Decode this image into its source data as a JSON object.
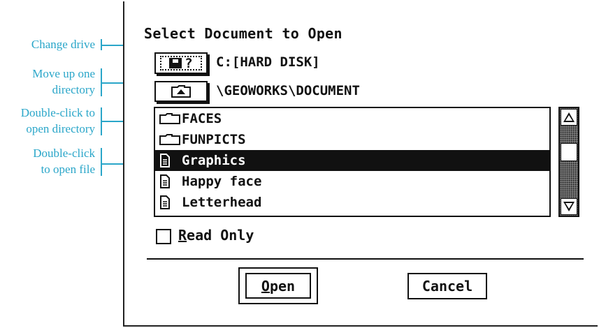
{
  "callouts": {
    "change_drive": "Change drive",
    "move_up_line1": "Move up one",
    "move_up_line2": "directory",
    "open_dir_line1": "Double-click to",
    "open_dir_line2": "open directory",
    "open_file_line1": "Double-click",
    "open_file_line2": "to open file"
  },
  "dialog": {
    "title": "Select Document to Open",
    "drive_button_label": "?",
    "drive_label": "C:[HARD DISK]",
    "path_label": "\\GEOWORKS\\DOCUMENT",
    "files": [
      {
        "name": "FACES",
        "type": "folder",
        "icon": "folder-icon",
        "selected": false
      },
      {
        "name": "FUNPICTS",
        "type": "folder",
        "icon": "folder-icon",
        "selected": false
      },
      {
        "name": "Graphics",
        "type": "file",
        "icon": "document-icon",
        "selected": true
      },
      {
        "name": "Happy face",
        "type": "file",
        "icon": "document-icon",
        "selected": false
      },
      {
        "name": "Letterhead",
        "type": "file",
        "icon": "document-icon",
        "selected": false
      }
    ],
    "read_only_label": "Read Only",
    "read_only_checked": false,
    "open_button": "Open",
    "cancel_button": "Cancel"
  },
  "colors": {
    "callout": "#2aa6c9",
    "selection": "#111111"
  }
}
